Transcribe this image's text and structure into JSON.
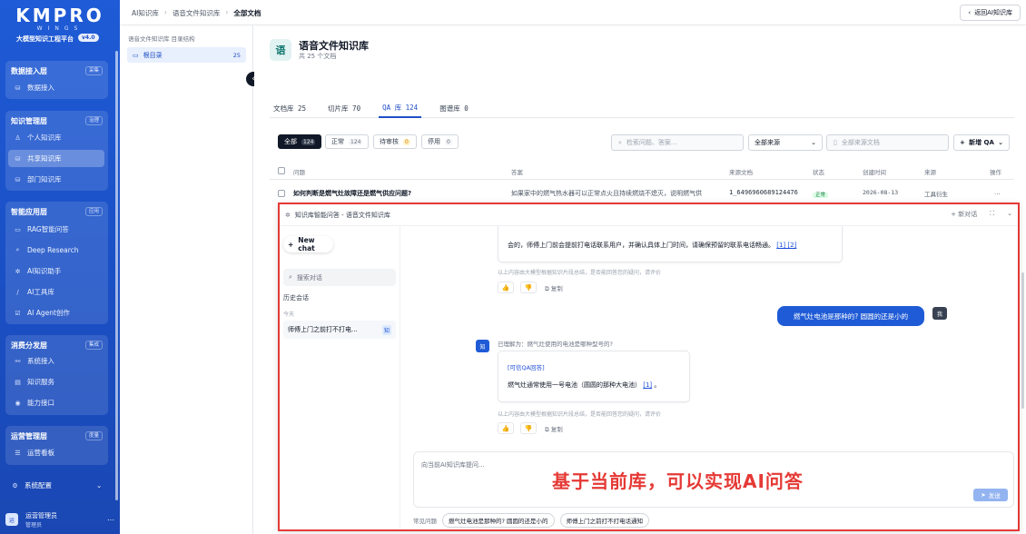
{
  "sidebar": {
    "brand": "KMPRO",
    "wings": "WINGS",
    "subtitle": "大模型知识工程平台",
    "version": "v4.0",
    "groups": [
      {
        "title": "数据接入层",
        "tag": "采集",
        "items": [
          {
            "label": "数据接入",
            "icon": "database-icon"
          }
        ]
      },
      {
        "title": "知识管理层",
        "tag": "治理",
        "items": [
          {
            "label": "个人知识库",
            "icon": "user-icon"
          },
          {
            "label": "共享知识库",
            "icon": "database-icon"
          },
          {
            "label": "部门知识库",
            "icon": "database-icon"
          }
        ]
      },
      {
        "title": "智能应用层",
        "tag": "应用",
        "items": [
          {
            "label": "RAG智能问答",
            "icon": "chat-icon"
          },
          {
            "label": "Deep Research",
            "icon": "search-icon"
          },
          {
            "label": "AI知识助手",
            "icon": "sparkle-icon"
          },
          {
            "label": "AI工具库",
            "icon": "wand-icon"
          },
          {
            "label": "AI Agent创作",
            "icon": "check-icon"
          }
        ]
      },
      {
        "title": "消费分发层",
        "tag": "集成",
        "items": [
          {
            "label": "系统接入",
            "icon": "link-icon"
          },
          {
            "label": "知识服务",
            "icon": "book-icon"
          },
          {
            "label": "能力接口",
            "icon": "api-icon"
          }
        ]
      },
      {
        "title": "运营管理层",
        "tag": "度量",
        "items": [
          {
            "label": "运营看板",
            "icon": "list-icon"
          }
        ]
      }
    ],
    "system_config": "系统配置",
    "user_name": "运营管理员",
    "user_role": "管理员",
    "user_avatar": "运"
  },
  "topbar": {
    "crumbs": [
      "AI知识库",
      "语音文件知识库",
      "全部文档"
    ],
    "back_label": "返回AI知识库"
  },
  "tree": {
    "title": "语音文件知识库 目录结构",
    "root_label": "根目录",
    "root_count": "25"
  },
  "kb": {
    "icon_char": "语",
    "title": "语音文件知识库",
    "subtitle": "共 25 个文档",
    "tabs": [
      "文档库 25",
      "切片库 70",
      "QA 库 124",
      "图谱库 0"
    ],
    "filters": [
      {
        "label": "全部",
        "count": "124"
      },
      {
        "label": "正常",
        "count": "124"
      },
      {
        "label": "待审核",
        "count": "0"
      },
      {
        "label": "停用",
        "count": "0"
      }
    ],
    "search_placeholder": "检索问题、答案...",
    "source_select": "全部来源",
    "source_search_placeholder": "全部来源文档",
    "add_label": "新增 QA",
    "columns": [
      "问题",
      "答案",
      "来源文档",
      "状态",
      "创建时间",
      "来源",
      "操作"
    ],
    "row": {
      "question": "如何判断是燃气灶故障还是燃气供应问题?",
      "answer": "如果家中的燃气热水器可以正常点火且持续燃烧不熄灭，说明燃气供",
      "source_doc": "1_6496960689124476",
      "status": "正常",
      "created": "2026-08-13",
      "origin": "工具衍生",
      "action": "..."
    }
  },
  "chat": {
    "title": "知识库智能问答 - 语音文件知识库",
    "new_session": "新对话",
    "new_chat": "New chat",
    "search_placeholder": "搜索对话",
    "history_label": "历史会话",
    "today_label": "今天",
    "history_item": "师傅上门之前打不打电...",
    "history_item_tag": "知",
    "prev_answer": "会的，师傅上门前会提前打电话联系用户，并确认具体上门时间，请确保预留的联系电话畅通。",
    "prev_refs": "[1] [2]",
    "disclaimer": "以上内容由大模型根据知识片段总结，是否能回答您的疑问，请评价",
    "copy_label": "复制",
    "user_question": "燃气灶电池是那种的? 圆圆的还是小的",
    "user_avatar": "我",
    "bot_avatar": "知",
    "understood": "已理解为：燃气灶使用的电池是哪种型号的?",
    "qa_tag": "[可信QA回答]",
    "answer": "燃气灶通常使用一号电池（圆圆的那种大电池）",
    "answer_ref": "[1]",
    "answer_end": "。",
    "input_placeholder": "向当前AI知识库提问...",
    "send_label": "发送",
    "quick_label": "常见问题",
    "quick_items": [
      "燃气灶电池是那种的? 圆圆的还是小的",
      "师傅上门之前打不打电话通知"
    ],
    "overlay_text": "基于当前库，可以实现AI问答"
  },
  "colors": {
    "brand": "#1f5bd6",
    "highlight": "#e53935"
  }
}
